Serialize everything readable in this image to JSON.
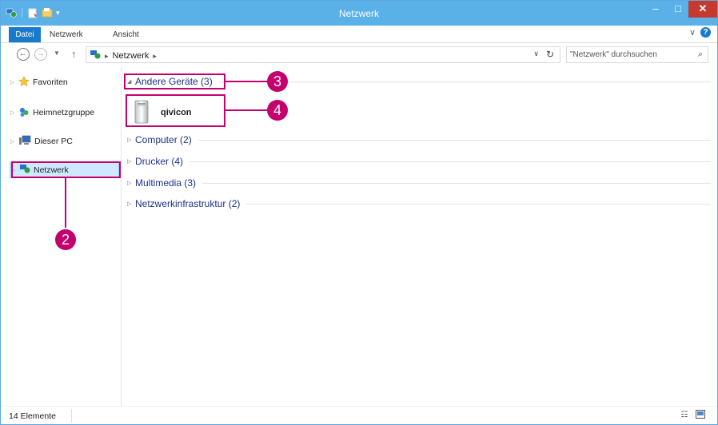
{
  "window": {
    "title": "Netzwerk",
    "controls": {
      "minimize": "–",
      "maximize": "□",
      "close": "✕"
    }
  },
  "ribbon": {
    "tabs": [
      "Datei",
      "Netzwerk",
      "Ansicht"
    ],
    "expand": "∨",
    "help": "?"
  },
  "address": {
    "segments": [
      "Netzwerk"
    ],
    "search_placeholder": "\"Netzwerk\" durchsuchen"
  },
  "nav_pane": {
    "items": [
      {
        "label": "Favoriten",
        "icon": "star-icon"
      },
      {
        "label": "Heimnetzgruppe",
        "icon": "homegroup-icon"
      },
      {
        "label": "Dieser PC",
        "icon": "computer-icon"
      },
      {
        "label": "Netzwerk",
        "icon": "network-icon",
        "selected": true
      }
    ]
  },
  "content": {
    "groups": [
      {
        "label": "Andere Geräte (3)",
        "expanded": true
      },
      {
        "label": "Computer (2)",
        "expanded": false
      },
      {
        "label": "Drucker (4)",
        "expanded": false
      },
      {
        "label": "Multimedia (3)",
        "expanded": false
      },
      {
        "label": "Netzwerkinfrastruktur (2)",
        "expanded": false
      }
    ],
    "devices": [
      {
        "label": "qivicon",
        "icon": "device-tower-icon"
      }
    ]
  },
  "callouts": [
    "2",
    "3",
    "4"
  ],
  "status": {
    "count": "14 Elemente"
  },
  "colors": {
    "titlebar": "#59b1e8",
    "accent": "#1979ca",
    "callout": "#c3006b",
    "group_text": "#1e3287",
    "selection": "#cde8ff"
  }
}
